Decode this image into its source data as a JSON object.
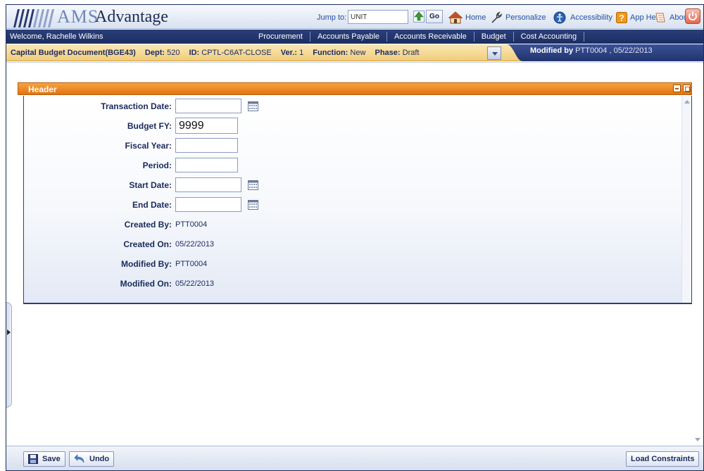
{
  "app": {
    "logo_prefix": "AMS",
    "logo_name": "Advantage"
  },
  "topbar": {
    "jump_label": "Jump to:",
    "jump_value": "UNIT",
    "go_label": "Go",
    "links": {
      "home": "Home",
      "personalize": "Personalize",
      "accessibility": "Accessibility",
      "app_help": "App Help",
      "about": "About"
    }
  },
  "nav": {
    "welcome": "Welcome, Rachelle Wilkins",
    "menu": [
      "Procurement",
      "Accounts Payable",
      "Accounts Receivable",
      "Budget",
      "Cost Accounting"
    ]
  },
  "doc": {
    "name": "Capital Budget Document(BGE43)",
    "dept_label": "Dept:",
    "dept": "520",
    "id_label": "ID:",
    "id": "CPTL-C6AT-CLOSE",
    "ver_label": "Ver.:",
    "ver": "1",
    "function_label": "Function:",
    "function": "New",
    "phase_label": "Phase:",
    "phase": "Draft",
    "modified_prefix": "Modified by",
    "modified_by": "PTT0004 , 05/22/2013"
  },
  "panel": {
    "title": "Header"
  },
  "form": {
    "transaction_date": {
      "label": "Transaction Date:",
      "value": ""
    },
    "budget_fy": {
      "label": "Budget FY:",
      "value": "9999"
    },
    "fiscal_year": {
      "label": "Fiscal Year:",
      "value": ""
    },
    "period": {
      "label": "Period:",
      "value": ""
    },
    "start_date": {
      "label": "Start Date:",
      "value": ""
    },
    "end_date": {
      "label": "End Date:",
      "value": ""
    },
    "created_by": {
      "label": "Created By:",
      "value": "PTT0004"
    },
    "created_on": {
      "label": "Created On:",
      "value": "05/22/2013"
    },
    "modified_by": {
      "label": "Modified By:",
      "value": "PTT0004"
    },
    "modified_on": {
      "label": "Modified On:",
      "value": "05/22/2013"
    }
  },
  "bottom": {
    "save": "Save",
    "undo": "Undo",
    "load_constraints": "Load Constraints"
  },
  "colors": {
    "nav": "#1b2d62",
    "panel_header": "#e27410",
    "docbar": "#f0cd7b"
  }
}
